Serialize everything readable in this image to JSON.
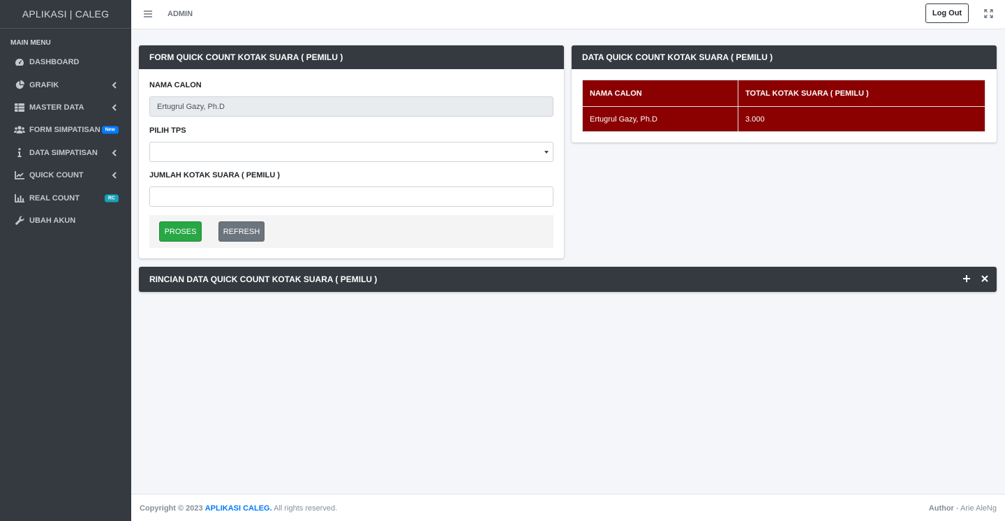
{
  "brand": "APLIKASI | CALEG",
  "sidebar": {
    "header": "MAIN MENU",
    "items": [
      {
        "label": "DASHBOARD",
        "icon": "dashboard-icon"
      },
      {
        "label": "GRAFIK",
        "icon": "pie-chart-icon",
        "chevron": true
      },
      {
        "label": "MASTER DATA",
        "icon": "table-icon",
        "chevron": true
      },
      {
        "label": "FORM SIMPATISAN",
        "icon": "users-icon",
        "badge": "New"
      },
      {
        "label": "DATA SIMPATISAN",
        "icon": "info-icon",
        "chevron": true
      },
      {
        "label": "QUICK COUNT",
        "icon": "line-chart-icon",
        "chevron": true
      },
      {
        "label": "REAL COUNT",
        "icon": "bar-chart-icon",
        "badge": "RC"
      },
      {
        "label": "UBAH AKUN",
        "icon": "wrench-icon"
      }
    ]
  },
  "header": {
    "user": "ADMIN",
    "logout_label": "Log Out"
  },
  "form_card": {
    "title": "FORM QUICK COUNT KOTAK SUARA ( PEMILU )",
    "nama_label": "NAMA CALON",
    "nama_value": "Ertugrul Gazy, Ph.D",
    "tps_label": "PILIH TPS",
    "tps_value": "",
    "jumlah_label": "JUMLAH KOTAK SUARA ( PEMILU )",
    "jumlah_value": "",
    "proses_label": "PROSES",
    "refresh_label": "REFRESH"
  },
  "data_card": {
    "title": "DATA QUICK COUNT KOTAK SUARA ( PEMILU )",
    "columns": [
      "NAMA CALON",
      "TOTAL KOTAK SUARA ( PEMILU )"
    ],
    "rows": [
      [
        "Ertugrul Gazy, Ph.D",
        "3.000"
      ]
    ],
    "row_color": "#8b0000"
  },
  "rincian_card": {
    "title": "RINCIAN DATA QUICK COUNT KOTAK SUARA ( PEMILU )"
  },
  "footer": {
    "copyright": "Copyright © 2023",
    "app_link": "APLIKASI CALEG.",
    "rights": "All rights reserved.",
    "author_label": "Author",
    "author_sep": "-",
    "author_name": "Arie AleNg"
  }
}
